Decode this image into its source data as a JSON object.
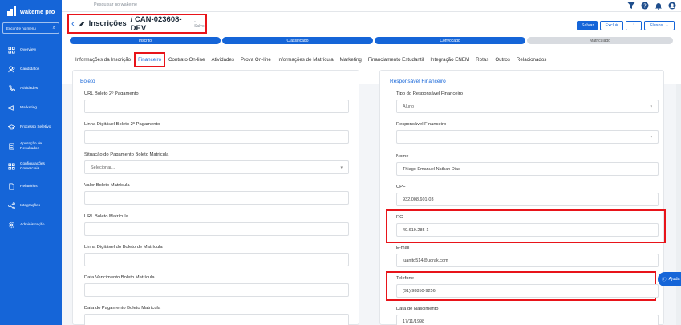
{
  "sidebar": {
    "brand": "wakeme pro",
    "search_placeholder": "Encontre no menu",
    "items": [
      {
        "label": "Overview",
        "icon": "grid-icon"
      },
      {
        "label": "Candidatos",
        "icon": "users-icon"
      },
      {
        "label": "Atividades",
        "icon": "phone-icon"
      },
      {
        "label": "Marketing",
        "icon": "megaphone-icon"
      },
      {
        "label": "Processo Seletivo",
        "icon": "cap-icon"
      },
      {
        "label": "Apuração de Resultados",
        "icon": "document-icon"
      },
      {
        "label": "Configurações Comerciais",
        "icon": "grid-icon"
      },
      {
        "label": "Relatórios",
        "icon": "file-icon"
      },
      {
        "label": "Integrações",
        "icon": "share-icon"
      },
      {
        "label": "Administração",
        "icon": "gear-icon"
      }
    ]
  },
  "topbar": {
    "search_placeholder": "Pesquisar no wakeme"
  },
  "header": {
    "title": "Inscrições",
    "code": "/ CAN-023608-DEV",
    "saved": "- Salvo",
    "actions": {
      "save": "Salvar",
      "delete": "Excluir",
      "more": "⋮",
      "flows": "Fluxos"
    }
  },
  "stages": [
    {
      "label": "Inscrito",
      "state": "done"
    },
    {
      "label": "Classificado",
      "state": "done"
    },
    {
      "label": "Convocado",
      "state": "done"
    },
    {
      "label": "Matriculado",
      "state": "todo"
    }
  ],
  "tabs": [
    "Informações da Inscrição",
    "Financeiro",
    "Contrato On-line",
    "Atividades",
    "Prova On-line",
    "Informações de Matrícula",
    "Marketing",
    "Financiamento Estudantil",
    "Integração ENEM",
    "Rotas",
    "Outros",
    "Relacionados"
  ],
  "left_panel": {
    "title": "Boleto",
    "fields": [
      {
        "label": "URL Boleto 2º Pagamento",
        "value": ""
      },
      {
        "label": "Linha Digitável Boleto 2º Pagamento",
        "value": ""
      },
      {
        "label": "Situação do Pagamento Boleto Matrícula",
        "value": "Selecionar..."
      },
      {
        "label": "Valor Boleto Matrícula",
        "value": ""
      },
      {
        "label": "URL Boleto Matrícula",
        "value": ""
      },
      {
        "label": "Linha Digitável do Boleto de Matrícula",
        "value": ""
      },
      {
        "label": "Data Vencimento Boleto Matrícula",
        "value": ""
      },
      {
        "label": "Data do Pagamento Boleto Matrícula",
        "value": ""
      }
    ]
  },
  "right_panel": {
    "title": "Responsável Financeiro",
    "fields": [
      {
        "label": "Tipo do Responsável Financeiro",
        "value": "Aluno"
      },
      {
        "label": "Responsável Financeiro",
        "value": ""
      },
      {
        "label": "Nome",
        "value": "Thiago Emanuel Nathan Dias"
      },
      {
        "label": "CPF",
        "value": "932.008.601-03"
      },
      {
        "label": "RG",
        "value": "49.619.285-1"
      },
      {
        "label": "E-mail",
        "value": "juanito514@uorak.com"
      },
      {
        "label": "Telefone",
        "value": "(91) 98850-9256"
      },
      {
        "label": "Data de Nascimento",
        "value": "17/11/1998"
      }
    ]
  },
  "help": {
    "label": "Ajuda"
  }
}
